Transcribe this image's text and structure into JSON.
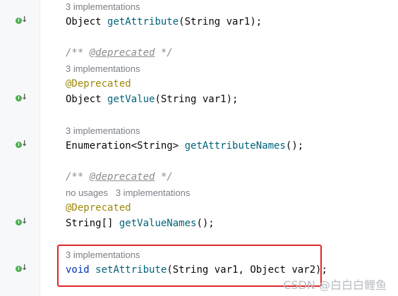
{
  "methods": [
    {
      "hint": "3 implementations",
      "return_type": "Object",
      "name": "getAttribute",
      "params": "(String var1);"
    },
    {
      "comment": "/** ",
      "comment_tag": "@deprecated",
      "comment_end": " */",
      "hint": "3 implementations",
      "annotation": "@Deprecated",
      "return_type": "Object",
      "name": "getValue",
      "params": "(String var1);"
    },
    {
      "hint": "3 implementations",
      "return_type": "Enumeration<String>",
      "name": "getAttributeNames",
      "params": "();"
    },
    {
      "comment": "/** ",
      "comment_tag": "@deprecated",
      "comment_end": " */",
      "usages": "no usages",
      "hint": "3 implementations",
      "annotation": "@Deprecated",
      "return_type": "String[]",
      "name": "getValueNames",
      "params": "();"
    },
    {
      "hint": "3 implementations",
      "return_type": "void",
      "name": "setAttribute",
      "params": "(String var1, Object var2);"
    }
  ],
  "gutter_icon": {
    "name": "implemented-interface-icon",
    "letter": "I",
    "color": "#4caf50"
  },
  "highlight_color": "#e0262c",
  "watermark": "CSDN @白白白鲤鱼"
}
